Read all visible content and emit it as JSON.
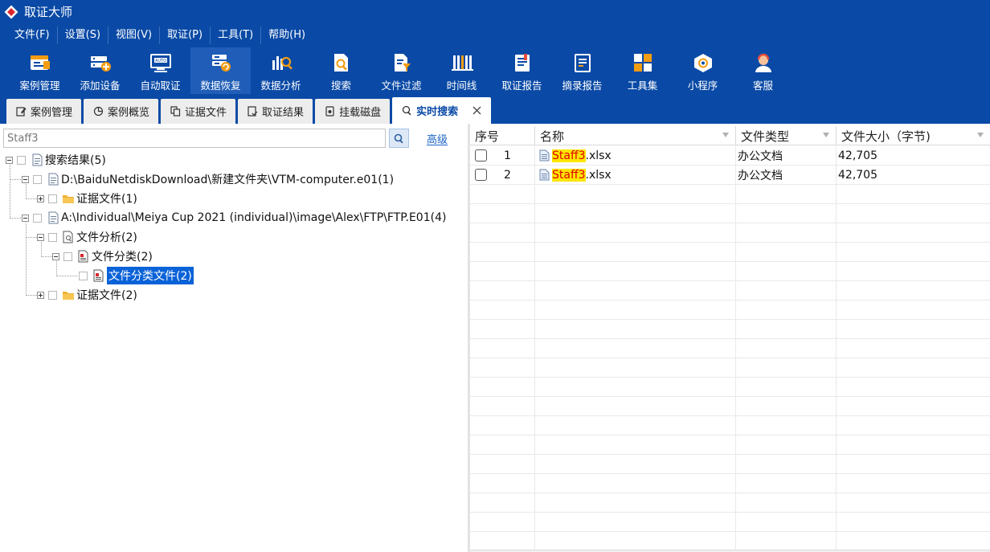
{
  "app": {
    "title": "取证大师"
  },
  "menu": [
    {
      "label": "文件(F)"
    },
    {
      "label": "设置(S)"
    },
    {
      "label": "视图(V)"
    },
    {
      "label": "取证(P)"
    },
    {
      "label": "工具(T)"
    },
    {
      "label": "帮助(H)"
    }
  ],
  "toolbar": [
    {
      "label": "案例管理",
      "icon": "case-management-icon"
    },
    {
      "label": "添加设备",
      "icon": "add-device-icon"
    },
    {
      "label": "自动取证",
      "icon": "auto-forensics-icon"
    },
    {
      "label": "数据恢复",
      "icon": "data-recovery-icon",
      "active": true
    },
    {
      "label": "数据分析",
      "icon": "data-analysis-icon"
    },
    {
      "label": "搜索",
      "icon": "search-doc-icon"
    },
    {
      "label": "文件过滤",
      "icon": "file-filter-icon"
    },
    {
      "label": "时间线",
      "icon": "timeline-icon"
    },
    {
      "label": "取证报告",
      "icon": "forensic-report-icon"
    },
    {
      "label": "摘录报告",
      "icon": "excerpt-report-icon"
    },
    {
      "label": "工具集",
      "icon": "toolset-icon"
    },
    {
      "label": "小程序",
      "icon": "mini-program-icon"
    },
    {
      "label": "客服",
      "icon": "customer-service-icon"
    }
  ],
  "tabs": [
    {
      "label": "案例管理"
    },
    {
      "label": "案例概览"
    },
    {
      "label": "证据文件"
    },
    {
      "label": "取证结果"
    },
    {
      "label": "挂载磁盘"
    },
    {
      "label": "实时搜索",
      "active": true
    }
  ],
  "search": {
    "value": "Staff3",
    "advanced_label": "高级"
  },
  "tree": [
    {
      "label": "搜索结果(5)"
    },
    {
      "label": "D:\\BaiduNetdiskDownload\\新建文件夹\\VTM-computer.e01(1)"
    },
    {
      "label": "证据文件(1)"
    },
    {
      "label": "A:\\Individual\\Meiya Cup 2021 (individual)\\image\\Alex\\FTP\\FTP.E01(4)"
    },
    {
      "label": "文件分析(2)"
    },
    {
      "label": "文件分类(2)"
    },
    {
      "label": "文件分类文件(2)",
      "selected": true
    },
    {
      "label": "证据文件(2)"
    }
  ],
  "grid": {
    "columns": [
      "序号",
      "名称",
      "文件类型",
      "文件大小（字节)"
    ],
    "rows": [
      {
        "num": "1",
        "name_match": "Staff3",
        "name_rest": ".xlsx",
        "type": "办公文档",
        "size": "42,705"
      },
      {
        "num": "2",
        "name_match": "Staff3",
        "name_rest": ".xlsx",
        "type": "办公文档",
        "size": "42,705"
      }
    ]
  }
}
